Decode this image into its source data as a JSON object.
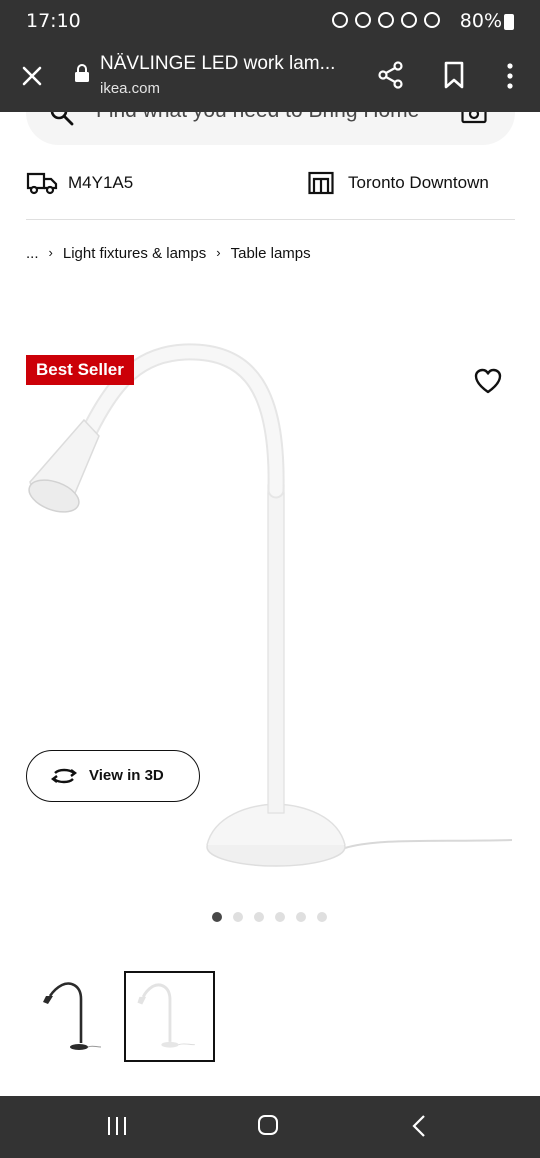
{
  "status_bar": {
    "time": "17:10",
    "battery": "80%"
  },
  "url_bar": {
    "title": "NÄVLINGE LED work lam...",
    "domain": "ikea.com"
  },
  "search": {
    "placeholder": "Find what you need to Bring Home"
  },
  "delivery": {
    "postal_code": "M4Y1A5",
    "store": "Toronto Downtown"
  },
  "breadcrumb": {
    "ellipsis": "...",
    "items": [
      "Light fixtures & lamps",
      "Table lamps"
    ]
  },
  "product": {
    "badge": "Best Seller",
    "view3d_label": "View in 3D"
  },
  "carousel": {
    "dot_count": 6,
    "active_index": 0
  },
  "colors": {
    "badge": "#cc0008",
    "chrome": "#333333"
  },
  "icons": [
    "close-icon",
    "lock-icon",
    "share-icon",
    "bookmark-icon",
    "menu-icon",
    "search-icon",
    "camera-icon",
    "truck-icon",
    "store-icon",
    "heart-icon",
    "rotate-icon"
  ]
}
